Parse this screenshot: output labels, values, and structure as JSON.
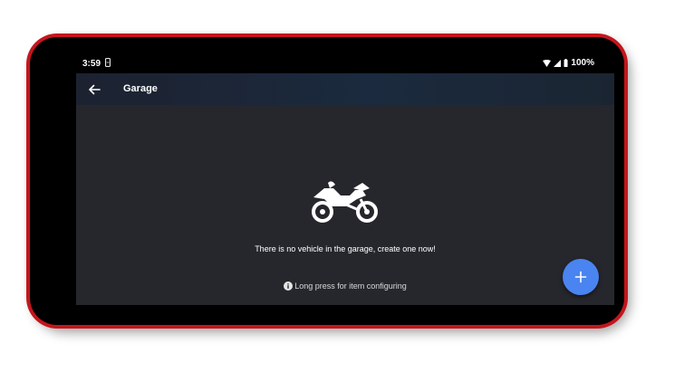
{
  "status_bar": {
    "time": "3:59",
    "battery": "100%",
    "icons": [
      "sim-icon",
      "wifi-icon",
      "signal-icon",
      "battery-icon"
    ]
  },
  "app_bar": {
    "title": "Garage",
    "back_icon": "arrow-back-icon"
  },
  "empty_state": {
    "icon": "motorcycle-icon",
    "message": "There is no vehicle in the garage, create one now!"
  },
  "hint": {
    "icon": "info-icon",
    "text": "Long press for item configuring"
  },
  "fab": {
    "icon": "plus-icon",
    "color": "#4a84f0"
  },
  "colors": {
    "phone_frame": "#c4161c",
    "background": "#26272c"
  }
}
